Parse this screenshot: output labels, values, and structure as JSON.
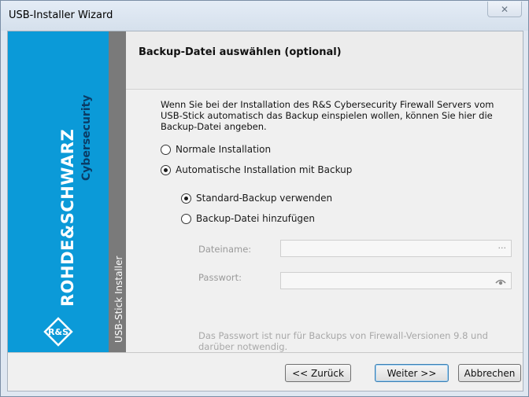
{
  "window": {
    "title": "USB-Installer Wizard",
    "close_glyph": "✕"
  },
  "branding": {
    "company": "ROHDE&SCHWARZ",
    "product": "Cybersecurity",
    "logo_text": "R&S",
    "side_label": "USB-Stick Installer"
  },
  "header": {
    "title": "Backup-Datei auswählen (optional)"
  },
  "content": {
    "description": "Wenn Sie bei der Installation des R&S Cybersecurity Firewall Servers vom USB-Stick automatisch das Backup einspielen wollen, können Sie hier die Backup-Datei angeben.",
    "options": [
      {
        "label": "Normale Installation",
        "selected": false
      },
      {
        "label": "Automatische Installation mit Backup",
        "selected": true
      }
    ],
    "sub_options": [
      {
        "label": "Standard-Backup verwenden",
        "selected": true
      },
      {
        "label": "Backup-Datei hinzufügen",
        "selected": false
      }
    ],
    "filename": {
      "label": "Dateiname:",
      "value": "",
      "browse_glyph": "···"
    },
    "password": {
      "label": "Passwort:",
      "value": "",
      "reveal_icon": "eye-icon"
    },
    "note": "Das Passwort ist nur für Backups von Firewall-Versionen 9.8 und darüber notwendig."
  },
  "buttons": {
    "back": "<< Zurück",
    "next": "Weiter >>",
    "cancel": "Abbrechen"
  }
}
